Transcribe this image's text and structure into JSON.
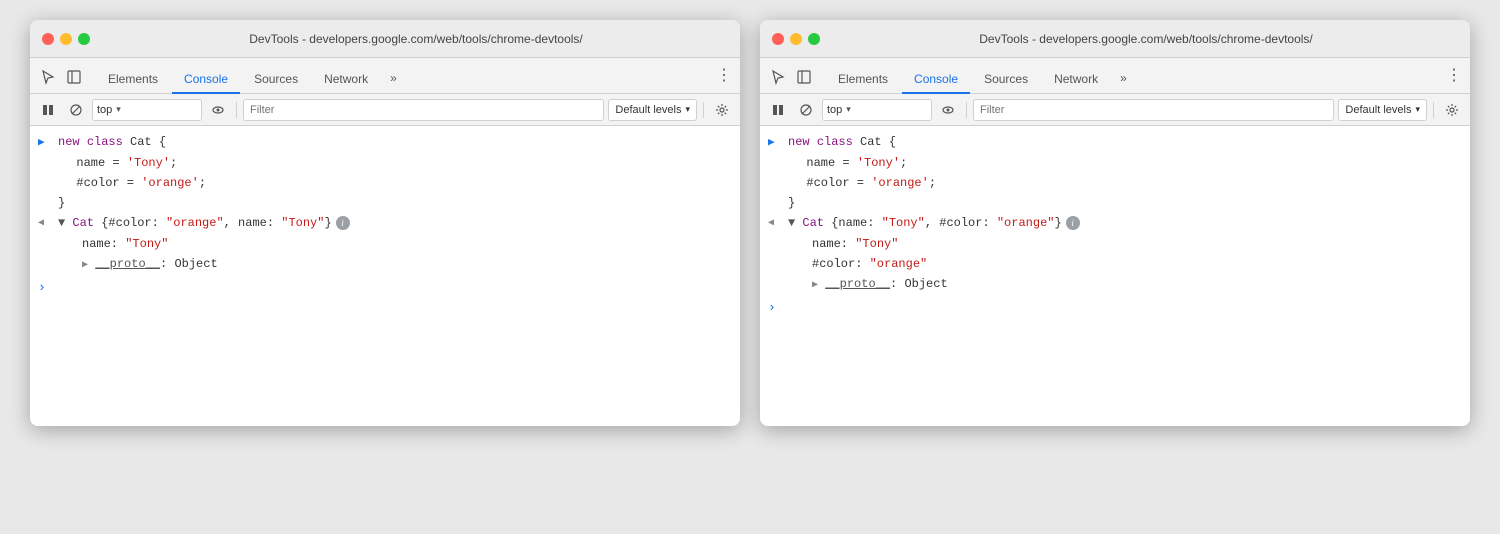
{
  "windows": [
    {
      "id": "window-left",
      "title_bar": {
        "text": "DevTools - developers.google.com/web/tools/chrome-devtools/"
      },
      "tabs": {
        "items": [
          {
            "label": "Elements",
            "active": false
          },
          {
            "label": "Console",
            "active": true
          },
          {
            "label": "Sources",
            "active": false
          },
          {
            "label": "Network",
            "active": false
          }
        ],
        "more": "»",
        "menu": "⋮"
      },
      "toolbar": {
        "pause_icon": "▶",
        "block_icon": "🚫",
        "top_label": "top",
        "dropdown_arrow": "▾",
        "eye_icon": "👁",
        "filter_placeholder": "Filter",
        "levels_label": "Default levels",
        "levels_arrow": "▾",
        "gear_icon": "⚙"
      },
      "console": {
        "lines": [
          {
            "type": "input",
            "gutter": ">",
            "indent": 0,
            "content": "new class Cat {"
          },
          {
            "type": "code",
            "gutter": "",
            "indent": 1,
            "content": "name = 'Tony';"
          },
          {
            "type": "code",
            "gutter": "",
            "indent": 1,
            "content": "#color = 'orange';"
          },
          {
            "type": "code",
            "gutter": "",
            "indent": 0,
            "content": "}"
          },
          {
            "type": "output-collapsed",
            "gutter": "<",
            "content_prefix": "▼ Cat {#color: ",
            "color_str": "\"orange\"",
            "content_mid": ", name: ",
            "name_str": "\"Tony\"",
            "content_suffix": "}",
            "has_info": true
          },
          {
            "type": "prop",
            "indent": 1,
            "label": "name: ",
            "value": "\"Tony\""
          },
          {
            "type": "proto-collapsed",
            "indent": 1,
            "content": "▶ __proto__: Object"
          },
          {
            "type": "prompt"
          }
        ]
      }
    },
    {
      "id": "window-right",
      "title_bar": {
        "text": "DevTools - developers.google.com/web/tools/chrome-devtools/"
      },
      "tabs": {
        "items": [
          {
            "label": "Elements",
            "active": false
          },
          {
            "label": "Console",
            "active": true
          },
          {
            "label": "Sources",
            "active": false
          },
          {
            "label": "Network",
            "active": false
          }
        ],
        "more": "»",
        "menu": "⋮"
      },
      "toolbar": {
        "pause_icon": "▶",
        "block_icon": "🚫",
        "top_label": "top",
        "dropdown_arrow": "▾",
        "eye_icon": "👁",
        "filter_placeholder": "Filter",
        "levels_label": "Default levels",
        "levels_arrow": "▾",
        "gear_icon": "⚙"
      },
      "console": {
        "lines": [
          {
            "type": "input",
            "gutter": ">",
            "indent": 0,
            "content": "new class Cat {"
          },
          {
            "type": "code",
            "gutter": "",
            "indent": 1,
            "content": "name = 'Tony';"
          },
          {
            "type": "code",
            "gutter": "",
            "indent": 1,
            "content": "#color = 'orange';"
          },
          {
            "type": "code",
            "gutter": "",
            "indent": 0,
            "content": "}"
          },
          {
            "type": "output-collapsed",
            "gutter": "<",
            "content_prefix": "▼ Cat {name: ",
            "name_str": "\"Tony\"",
            "content_mid": ", #color: ",
            "color_str": "\"orange\"",
            "content_suffix": "}",
            "has_info": true
          },
          {
            "type": "prop",
            "indent": 1,
            "label": "name: ",
            "value": "\"Tony\""
          },
          {
            "type": "prop",
            "indent": 1,
            "label": "#color: ",
            "value": "\"orange\""
          },
          {
            "type": "proto-collapsed",
            "indent": 1,
            "content": "▶ __proto__: Object"
          },
          {
            "type": "prompt"
          }
        ]
      }
    }
  ]
}
